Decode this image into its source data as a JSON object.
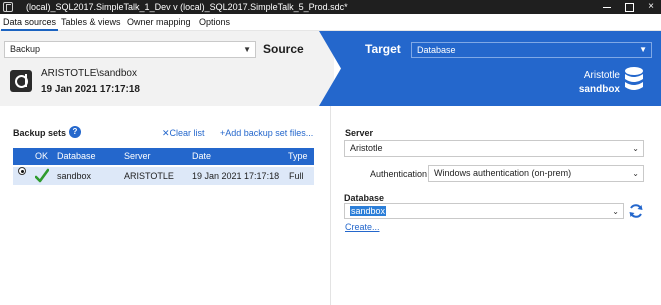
{
  "titlebar": {
    "title": "(local)_SQL2017.SimpleTalk_1_Dev v (local)_SQL2017.SimpleTalk_5_Prod.sdc*",
    "close_glyph": "×"
  },
  "menu": {
    "items": [
      "Data sources",
      "Tables & views",
      "Owner mapping",
      "Options"
    ],
    "active": "Data sources"
  },
  "source": {
    "type_value": "Backup",
    "heading": "Source",
    "server": "ARISTOTLE\\sandbox",
    "date": "19 Jan 2021 17:17:18"
  },
  "target": {
    "heading": "Target",
    "type_value": "Database",
    "server": "Aristotle",
    "database": "sandbox"
  },
  "backup_sets": {
    "title": "Backup sets",
    "help_glyph": "?",
    "clear_label": "✕Clear list",
    "add_label": "+Add backup set files...",
    "columns": [
      "OK",
      "Database",
      "Server",
      "Date",
      "Type"
    ],
    "rows": [
      {
        "database": "sandbox",
        "server": "ARISTOTLE",
        "date": "19 Jan 2021 17:17:18",
        "type": "Full",
        "ok": true,
        "selected": true
      }
    ]
  },
  "connection": {
    "server_label": "Server",
    "server_value": "Aristotle",
    "auth_label": "Authentication",
    "auth_value": "Windows authentication (on-prem)",
    "database_label": "Database",
    "database_value": "sandbox",
    "create_label": "Create..."
  },
  "colors": {
    "accent": "#2467cc",
    "source_bg": "#f2f2f2",
    "row_selected": "#dde8f8",
    "ok_green": "#2e9b2e"
  },
  "icons": [
    "app-icon",
    "minimize-icon",
    "maximize-icon",
    "close-icon",
    "chevron-down-icon",
    "database-backup-icon",
    "database-icon",
    "help-icon",
    "checkmark-icon",
    "refresh-icon"
  ]
}
